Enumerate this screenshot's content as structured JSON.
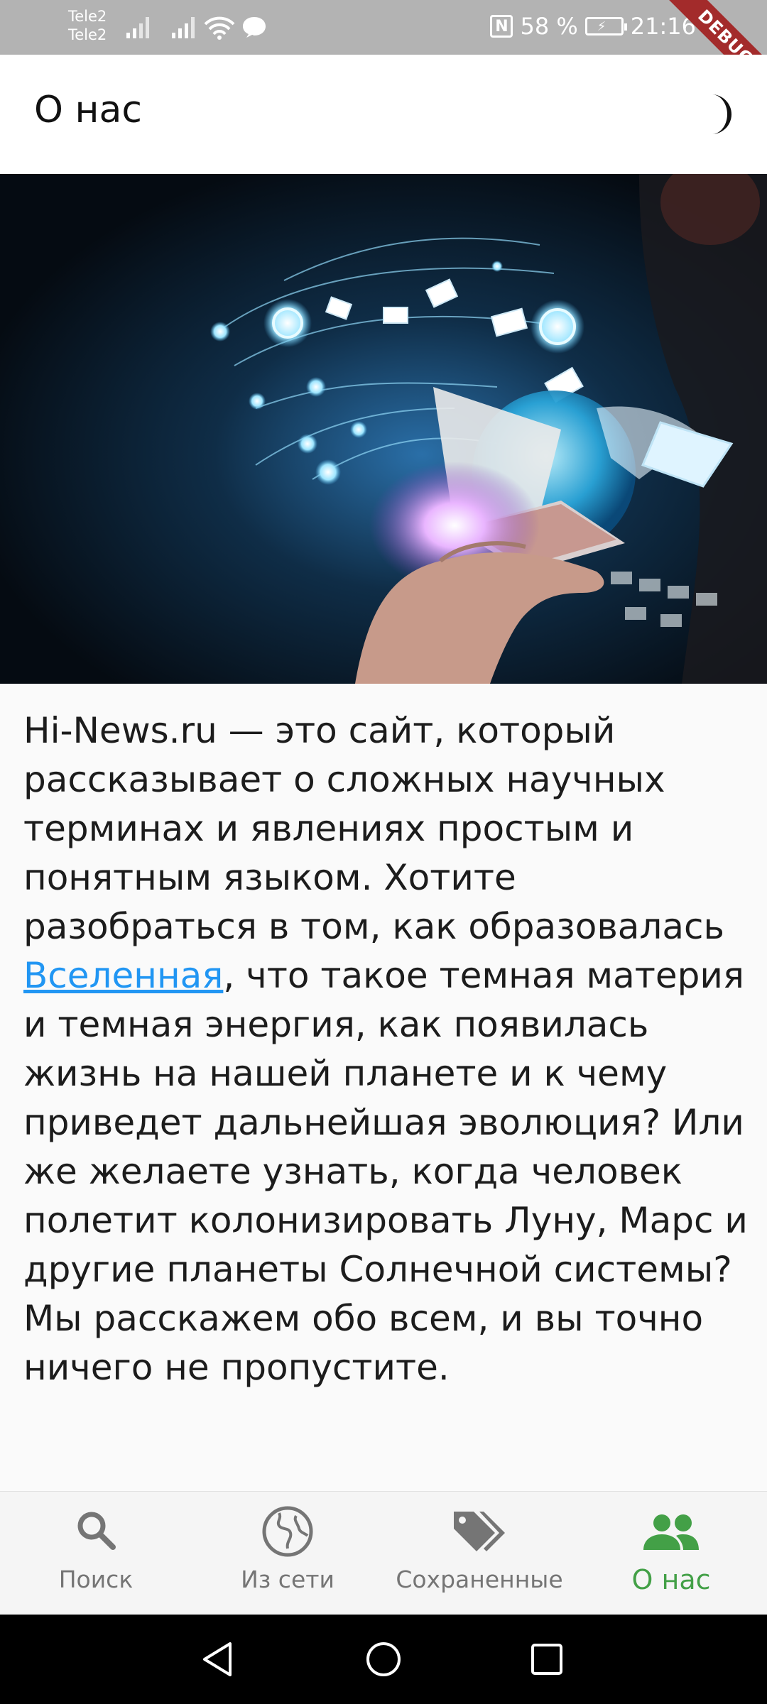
{
  "status_bar": {
    "carrier_1": "Tele2",
    "carrier_2": "Tele2",
    "nfc": "N",
    "battery_percent": "58 %",
    "time": "21:16",
    "debug_label": "DEBUG"
  },
  "app_bar": {
    "title": "О нас",
    "theme_toggle_icon": "moon-icon"
  },
  "hero": {
    "image_icon": "technology-network-hand-image"
  },
  "about": {
    "text_before_link": "Hi-News.ru — это сайт, который рассказывает о сложных научных терминах и явлениях простым и понятным языком. Хотите разобраться в том, как образовалась ",
    "link_text": "Вселенная",
    "text_after_link": ", что такое темная материя и темная энергия, как появилась жизнь на нашей планете и к чему приведет дальнейшая эволюция? Или же желаете узнать, когда человек полетит колонизировать Луну, Марс и другие планеты Солнечной системы? Мы расскажем обо всем, и вы точно ничего не пропустите.",
    "link_color": "#2196f3"
  },
  "bottom_nav": {
    "items": [
      {
        "label": "Поиск",
        "icon": "search-icon",
        "active": false
      },
      {
        "label": "Из сети",
        "icon": "globe-icon",
        "active": false
      },
      {
        "label": "Сохраненные",
        "icon": "tags-icon",
        "active": false
      },
      {
        "label": "О нас",
        "icon": "people-icon",
        "active": true
      }
    ],
    "active_color": "#43a047",
    "inactive_color": "#757575"
  },
  "system_nav": {
    "back_icon": "back-triangle-icon",
    "home_icon": "home-circle-icon",
    "recents_icon": "recents-square-icon"
  }
}
